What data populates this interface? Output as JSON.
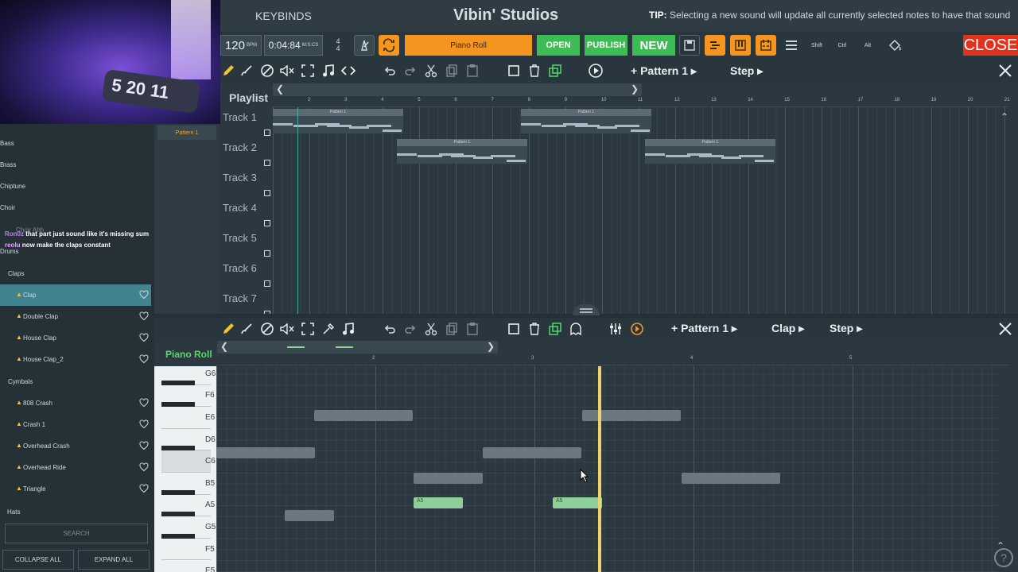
{
  "app": {
    "title": "Vibin' Studios",
    "keybinds_label": "KEYBINDS",
    "tip_label": "TIP:",
    "tip_text": "Selecting a new sound will update all currently selected notes to have that sound"
  },
  "toolbar": {
    "tempo": "120",
    "tempo_unit": "BPM",
    "time": "0:04:84",
    "time_unit": "M:S:CS",
    "time_sig_top": "4",
    "time_sig_bottom": "4",
    "view_label": "Piano Roll",
    "open_label": "OPEN",
    "publish_label": "PUBLISH",
    "new_label": "NEW",
    "shift_label": "Shift",
    "ctrl_label": "Ctrl",
    "alt_label": "Alt",
    "close_label": "CLOSE",
    "accent_orange": "#f5941e",
    "accent_green": "#3dbb55",
    "close_red": "#e0321c"
  },
  "playlist": {
    "title": "Playlist",
    "pattern_dropdown": "Pattern 1",
    "step_dropdown": "Step",
    "ruler": [
      "2",
      "3",
      "4",
      "5",
      "6",
      "7",
      "8",
      "9",
      "10",
      "11",
      "12",
      "13",
      "14",
      "15",
      "16",
      "17",
      "18",
      "19",
      "20",
      "21"
    ],
    "tracks": [
      "Track 1",
      "Track 2",
      "Track 3",
      "Track 4",
      "Track 5",
      "Track 6",
      "Track 7"
    ],
    "clip_label": "Pattern 1",
    "pattern_list": [
      "Pattern 1"
    ]
  },
  "pianoroll": {
    "title": "Piano Roll",
    "pattern_dropdown": "Pattern 1",
    "sound_dropdown": "Clap",
    "step_dropdown": "Step",
    "ruler": [
      "2",
      "3",
      "4",
      "5"
    ],
    "keys": [
      "G6",
      "F6",
      "E6",
      "D6",
      "C6",
      "B5",
      "A5",
      "G5",
      "F5",
      "E5"
    ],
    "note_label": "A5"
  },
  "sidebar": {
    "categories_top": [
      "Bass",
      "Brass",
      "Chiptune",
      "Choir"
    ],
    "choir_item": "Choir Ahh",
    "drums": "Drums",
    "claps": "Claps",
    "clap_items": [
      "Clap",
      "Double Clap",
      "House Clap",
      "House Clap_2"
    ],
    "cymbals": "Cymbals",
    "cymbal_items": [
      "808 Crash",
      "Crash 1",
      "Overhead Crash",
      "Overhead Ride",
      "Triangle"
    ],
    "hats": "Hats",
    "search_placeholder": "SEARCH",
    "collapse_label": "COLLAPSE ALL",
    "expand_label": "EXPAND ALL"
  },
  "chat": [
    {
      "user": "Ron0z",
      "text": "that part just sound like it's missing sum"
    },
    {
      "user": "reolu",
      "text": "now make the claps constant"
    }
  ]
}
